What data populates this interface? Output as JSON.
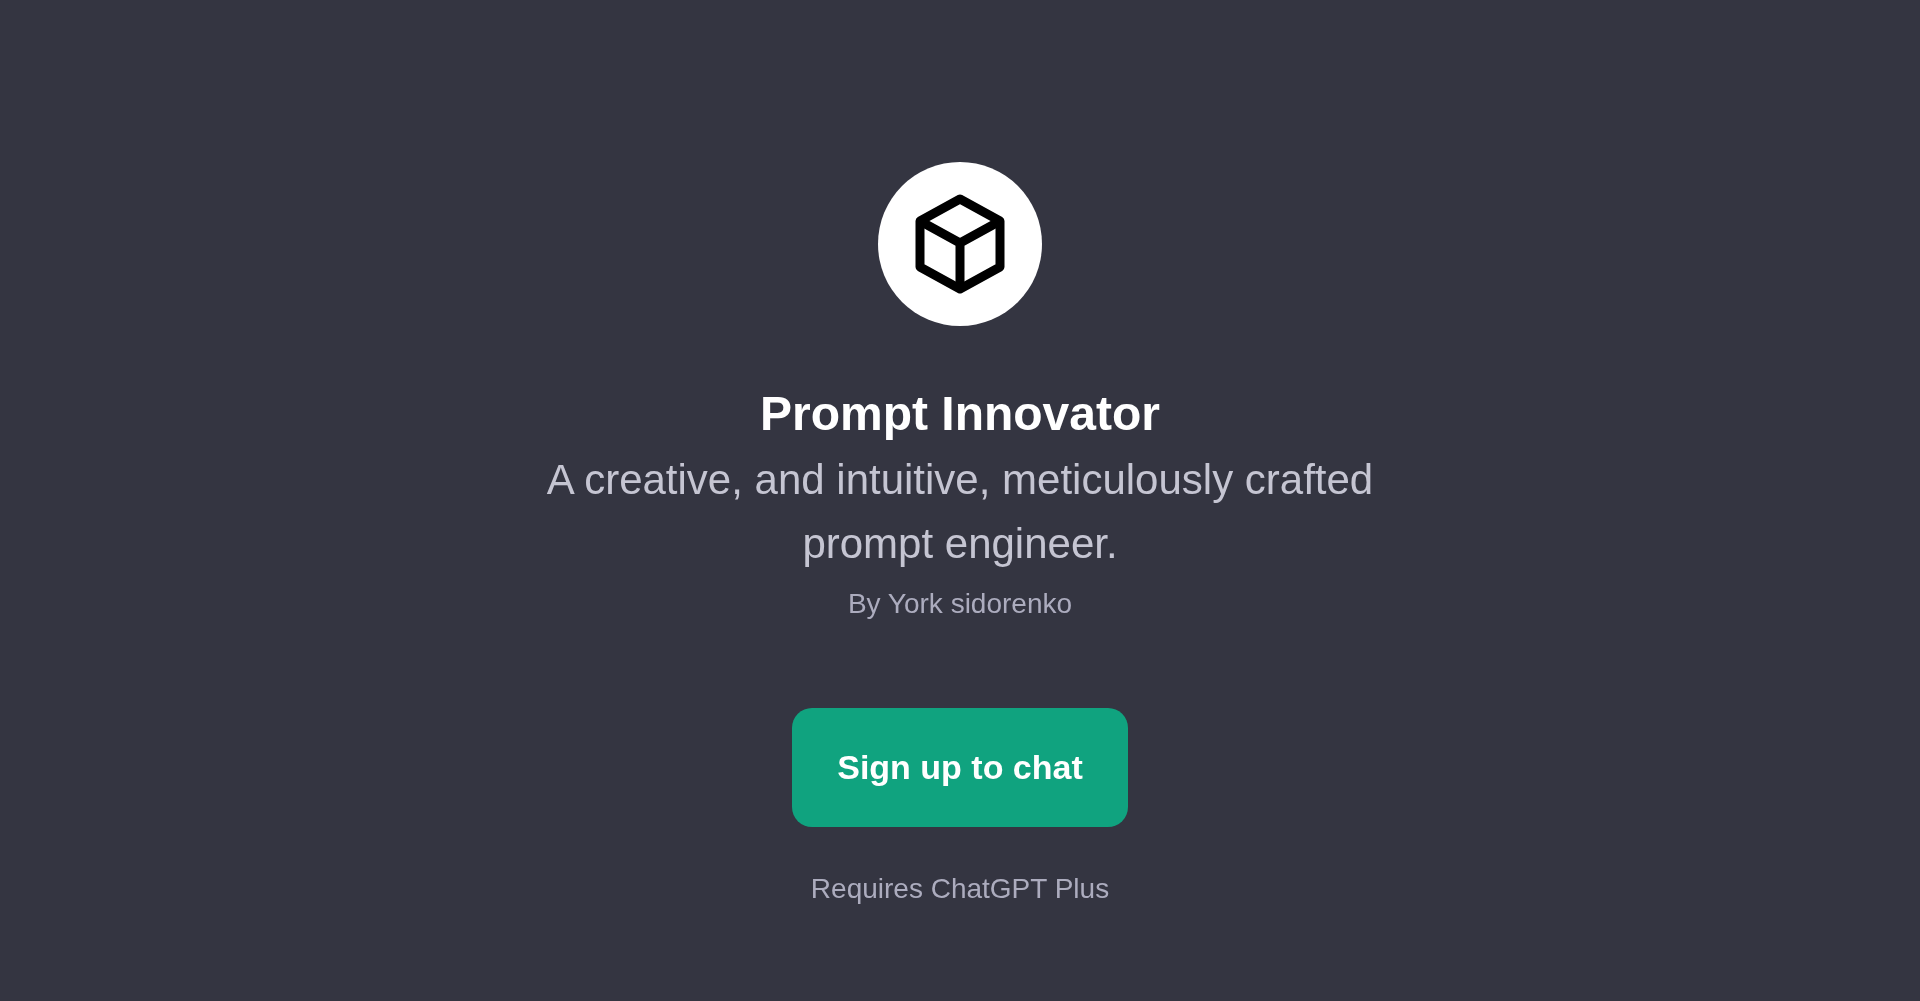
{
  "gizmo": {
    "title": "Prompt Innovator",
    "description": "A creative, and intuitive, meticulously crafted prompt engineer.",
    "author": "By York sidorenko"
  },
  "action": {
    "label": "Sign up to chat",
    "note": "Requires ChatGPT Plus"
  }
}
